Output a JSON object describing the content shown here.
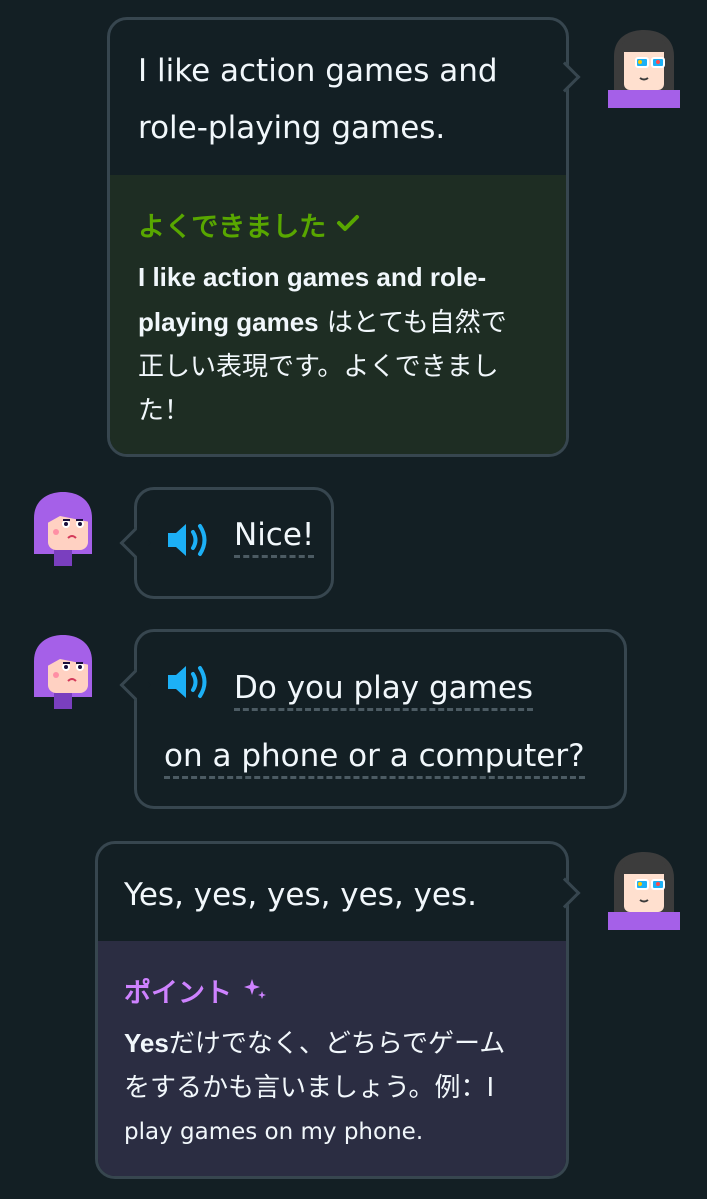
{
  "messages": [
    {
      "sender": "user",
      "text": "I like action games and role-playing games.",
      "lines": [
        "I like action games and",
        "role-playing games."
      ],
      "feedback": {
        "type": "praise",
        "title": "よくできました",
        "icon": "check-icon",
        "bold_lines": [
          "I like action games and role-",
          "playing games"
        ],
        "rest_lines": [
          " はとても自然で",
          "正しい表現です。よくできまし",
          "た！"
        ],
        "accent_color": "#58a700",
        "background": "#1e2d23"
      }
    },
    {
      "sender": "bot",
      "icon": "speaker-icon",
      "lines": [
        "Nice!"
      ]
    },
    {
      "sender": "bot",
      "icon": "speaker-icon",
      "lines": [
        "Do you play games",
        "on a phone or a computer?"
      ]
    },
    {
      "sender": "user",
      "text": "Yes, yes, yes, yes, yes.",
      "lines": [
        "Yes, yes, yes, yes, yes."
      ],
      "feedback": {
        "type": "tip",
        "title": "ポイント",
        "icon": "sparkle-icon",
        "bold_lines": [
          "Yes"
        ],
        "rest_lines": [
          "だけでなく、どちらでゲーム",
          "をするかも言いましょう。例：I",
          "play games on my phone."
        ],
        "accent_color": "#ce82ff",
        "background": "#2b2d42"
      }
    }
  ],
  "colors": {
    "background": "#131f24",
    "border": "#37464f",
    "text": "#f1f7fb",
    "speaker": "#1cb0f6"
  }
}
